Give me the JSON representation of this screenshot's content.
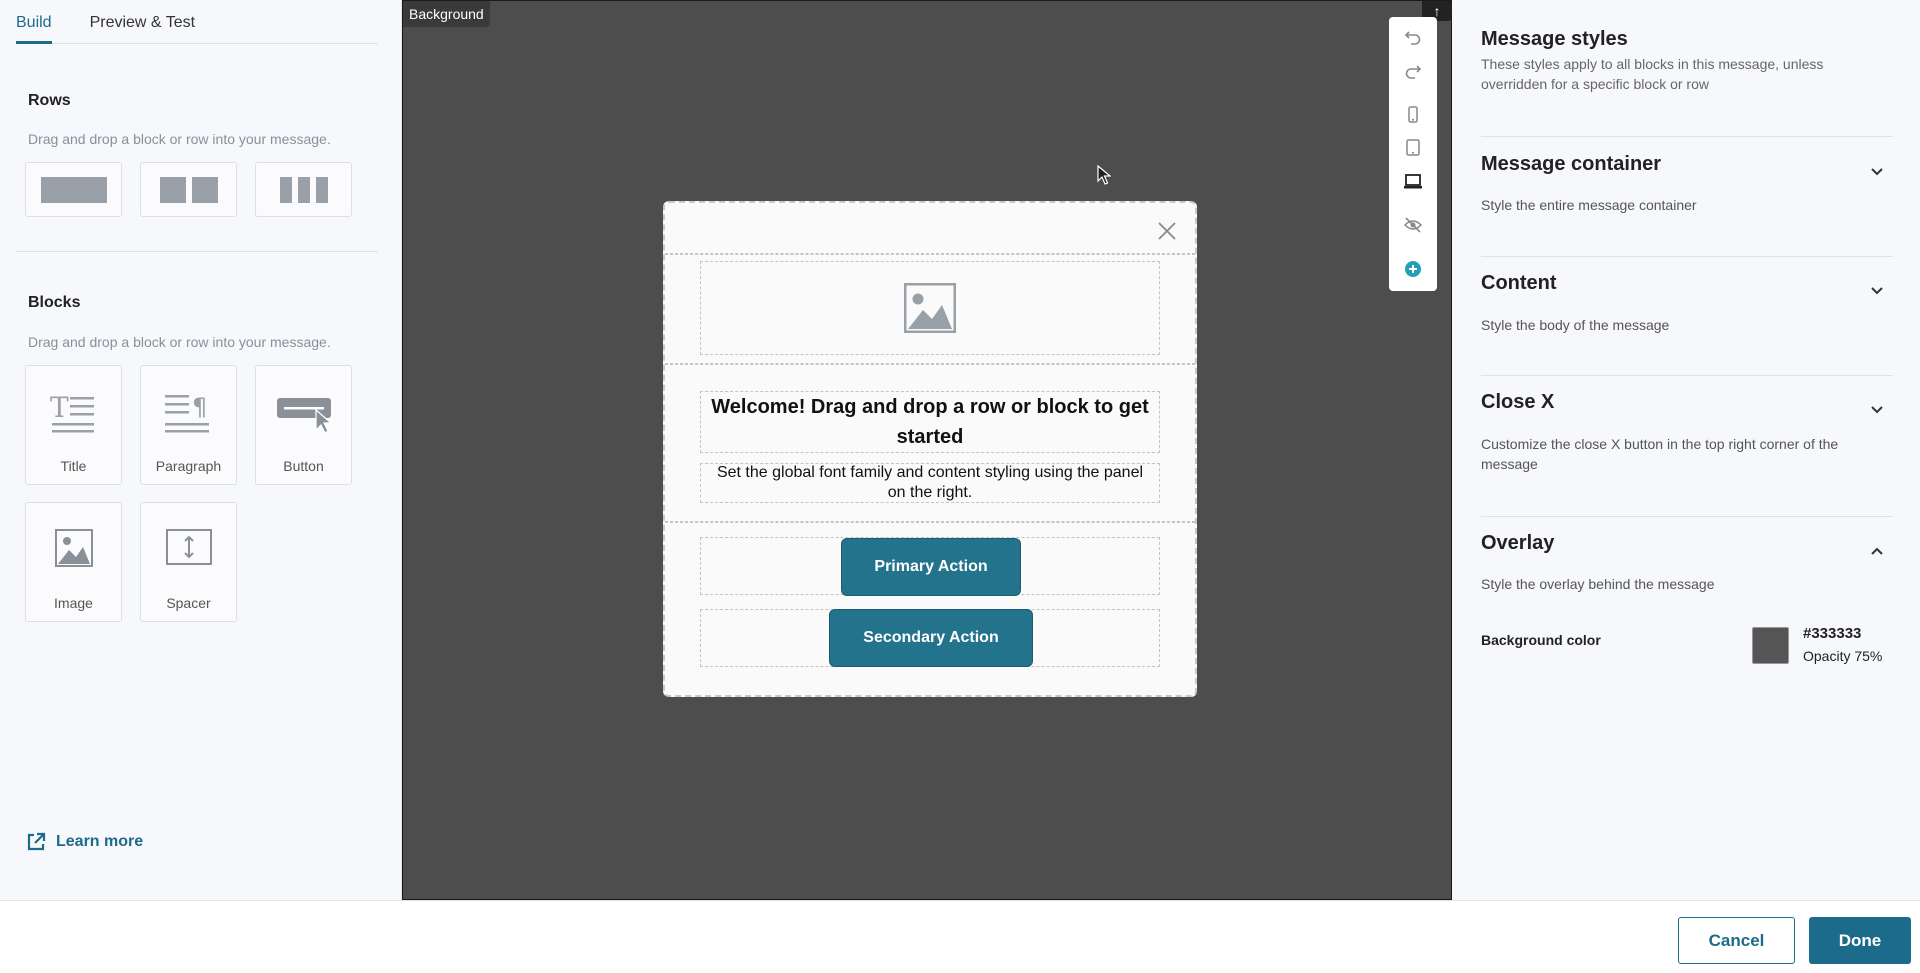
{
  "tabs": [
    {
      "label": "Build"
    },
    {
      "label": "Preview & Test"
    }
  ],
  "left": {
    "rows_title": "Rows",
    "rows_hint": "Drag and drop a block or row into your message.",
    "blocks_title": "Blocks",
    "blocks_hint": "Drag and drop a block or row into your message.",
    "blocks": [
      {
        "label": "Title",
        "icon": "title-icon"
      },
      {
        "label": "Paragraph",
        "icon": "paragraph-icon"
      },
      {
        "label": "Button",
        "icon": "button-icon"
      },
      {
        "label": "Image",
        "icon": "image-icon"
      },
      {
        "label": "Spacer",
        "icon": "spacer-icon"
      }
    ],
    "learn_more": "Learn more"
  },
  "canvas": {
    "background_label": "Background",
    "welcome": "Welcome! Drag and drop a row or block to get started",
    "subtext": "Set the global font family and content styling using the panel on the right.",
    "primary_action": "Primary Action",
    "secondary_action": "Secondary Action"
  },
  "right": {
    "title": "Message styles",
    "subtitle": "These styles apply to all blocks in this message, unless overridden for a specific block or row",
    "sections": [
      {
        "title": "Message container",
        "sub": "Style the entire message container"
      },
      {
        "title": "Content",
        "sub": "Style the body of the message"
      },
      {
        "title": "Close X",
        "sub": "Customize the close X button in the top right corner of the message"
      },
      {
        "title": "Overlay",
        "sub": "Style the overlay behind the message"
      }
    ],
    "bg_color_label": "Background color",
    "bg_color_value": "#333333",
    "bg_opacity": "Opacity 75%"
  },
  "footer": {
    "cancel": "Cancel",
    "done": "Done"
  },
  "colors": {
    "accent": "#1d6b8a",
    "button": "#24738d",
    "canvas_bg": "#4d4d4d"
  }
}
